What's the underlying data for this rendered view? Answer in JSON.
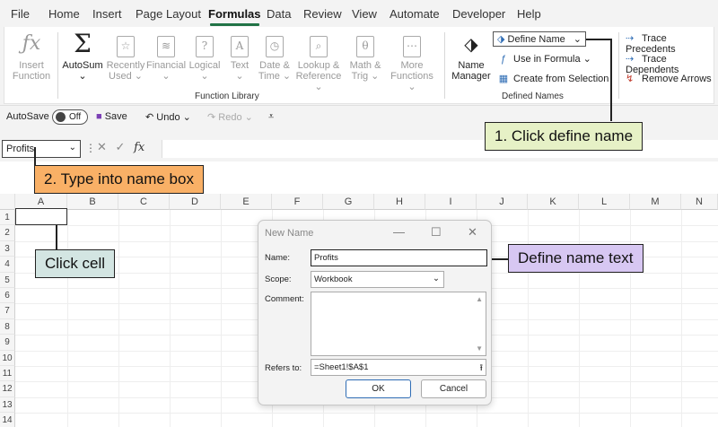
{
  "menu": {
    "tabs": [
      "File",
      "Home",
      "Insert",
      "Page Layout",
      "Formulas",
      "Data",
      "Review",
      "View",
      "Automate",
      "Developer",
      "Help"
    ],
    "active": "Formulas"
  },
  "ribbon": {
    "insert_function": {
      "line1": "Insert",
      "line2": "Function",
      "icon": "fx-icon"
    },
    "autosum": {
      "label": "AutoSum",
      "icon": "sigma-icon"
    },
    "recently_used": {
      "line1": "Recently",
      "line2": "Used ⌄"
    },
    "financial": {
      "line1": "Financial",
      "line2": "⌄"
    },
    "logical": {
      "line1": "Logical",
      "line2": "⌄"
    },
    "text": {
      "line1": "Text",
      "line2": "⌄"
    },
    "date_time": {
      "line1": "Date &",
      "line2": "Time ⌄"
    },
    "lookup_ref": {
      "line1": "Lookup &",
      "line2": "Reference ⌄"
    },
    "math_trig": {
      "line1": "Math &",
      "line2": "Trig ⌄"
    },
    "more_functions": {
      "line1": "More",
      "line2": "Functions ⌄"
    },
    "function_library_label": "Function Library",
    "name_manager": {
      "line1": "Name",
      "line2": "Manager"
    },
    "define_name": "Define Name",
    "use_in_formula": "Use in Formula",
    "create_from_selection": "Create from Selection",
    "defined_names_label": "Defined Names",
    "trace_precedents": "Trace Precedents",
    "trace_dependents": "Trace Dependents",
    "remove_arrows": "Remove Arrows"
  },
  "qat": {
    "autosave": "AutoSave",
    "toggle": "Off",
    "save": "Save",
    "undo": "Undo",
    "redo": "Redo"
  },
  "formula_bar": {
    "name_box_value": "Profits",
    "fx": "fx"
  },
  "grid": {
    "columns": [
      "A",
      "B",
      "C",
      "D",
      "E",
      "F",
      "G",
      "H",
      "I",
      "J",
      "K",
      "L",
      "M",
      "N"
    ],
    "rows": [
      "1",
      "2",
      "3",
      "4",
      "5",
      "6",
      "7",
      "8",
      "9",
      "10",
      "11",
      "12",
      "13",
      "14"
    ]
  },
  "callouts": {
    "step1": "1. Click define name",
    "step2": "2. Type into name box",
    "click_cell": "Click cell",
    "define_text": "Define name text"
  },
  "dialog": {
    "title": "New Name",
    "name_label": "Name:",
    "name_value": "Profits",
    "scope_label": "Scope:",
    "scope_value": "Workbook",
    "comment_label": "Comment:",
    "refers_label": "Refers to:",
    "refers_value": "=Sheet1!$A$1",
    "ok": "OK",
    "cancel": "Cancel"
  }
}
